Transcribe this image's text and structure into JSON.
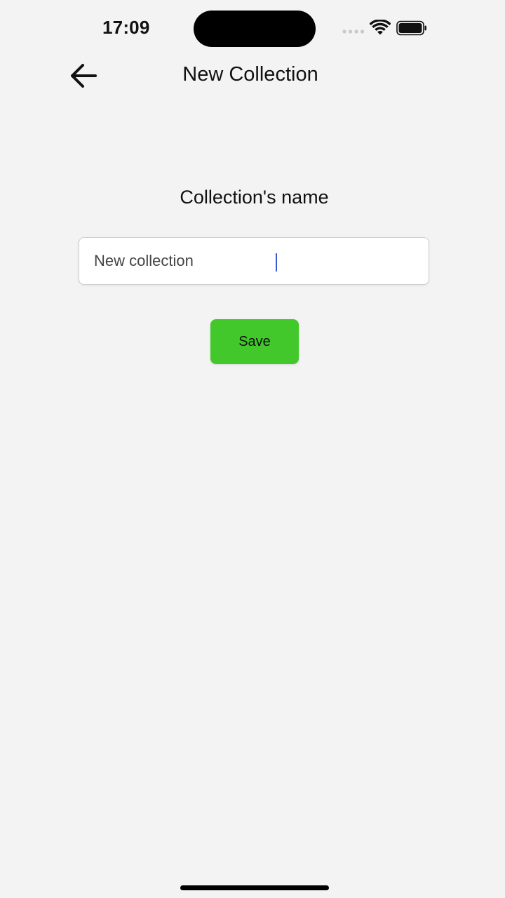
{
  "status_bar": {
    "time": "17:09",
    "signal_icon": "cellular-signal-dots-icon",
    "wifi_icon": "wifi-icon",
    "battery_icon": "battery-icon",
    "battery_level": 0.9
  },
  "header": {
    "back_icon": "arrow-left-icon",
    "title": "New Collection"
  },
  "form": {
    "label": "Collection's name",
    "name_value": "New collection",
    "save_label": "Save"
  },
  "colors": {
    "background": "#f3f3f3",
    "save_button": "#42c82b",
    "caret": "#3b5bd6"
  }
}
